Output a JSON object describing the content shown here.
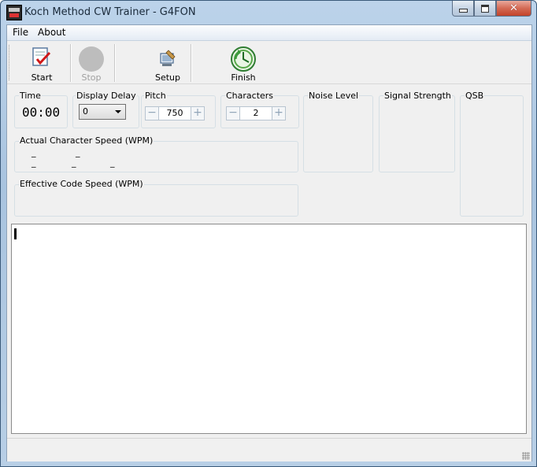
{
  "window": {
    "title": "Koch Method CW Trainer - G4FON"
  },
  "menu": {
    "file": "File",
    "about": "About"
  },
  "toolbar": {
    "start": "Start",
    "stop": "Stop",
    "setup": "Setup",
    "finish": "Finish"
  },
  "time": {
    "label": "Time",
    "value": "00:00"
  },
  "display_delay": {
    "label": "Display Delay",
    "value": "0"
  },
  "pitch": {
    "label": "Pitch",
    "value": "750"
  },
  "characters": {
    "label": "Characters",
    "value": "2"
  },
  "noise": {
    "label": "Noise Level"
  },
  "signal": {
    "label": "Signal Strength"
  },
  "qsb": {
    "label": "QSB"
  },
  "actual_speed": {
    "label": "Actual Character Speed (WPM)",
    "row1": [
      "_",
      "_"
    ],
    "row2": [
      "_",
      "_",
      "_"
    ]
  },
  "effective_speed": {
    "label": "Effective Code Speed (WPM)"
  },
  "stepper": {
    "minus": "−",
    "plus": "+"
  },
  "colors": {
    "accent": "#4a9a3a",
    "title_bar": "#bcd3ea"
  }
}
